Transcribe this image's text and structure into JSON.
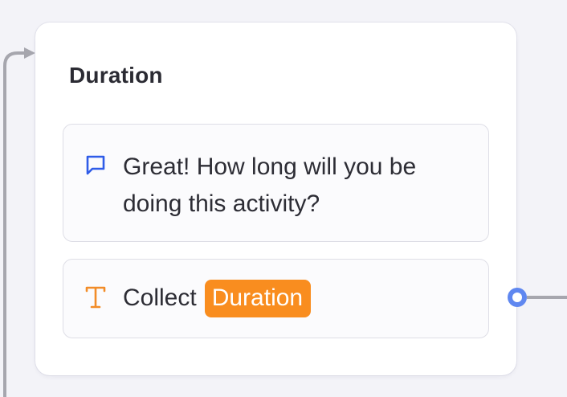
{
  "block": {
    "title": "Duration"
  },
  "steps": [
    {
      "type": "message",
      "icon": "chat-bubble-icon",
      "icon_color": "#2f5ce8",
      "text": "Great! How long will you be doing this activity?"
    },
    {
      "type": "capture",
      "icon": "text-t-icon",
      "icon_color": "#f28c28",
      "label": "Collect",
      "variable": "Duration",
      "variable_color": "#f98d1f"
    }
  ],
  "colors": {
    "canvas": "#f3f3f8",
    "connector": "#a6a6ae",
    "port": "#5f87f0"
  }
}
